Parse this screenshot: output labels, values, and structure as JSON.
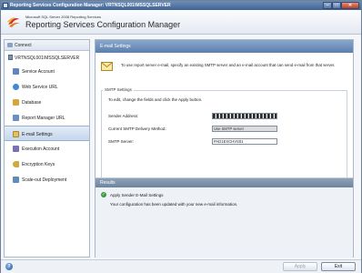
{
  "window": {
    "title": "Reporting Services Configuration Manager: VRTNSQL001\\MSSQLSERVER",
    "minimize_glyph": "–",
    "maximize_glyph": "□",
    "close_glyph": "✕"
  },
  "header": {
    "subtitle": "Microsoft SQL Server 2008 Reporting Services",
    "title": "Reporting Services Configuration Manager",
    "logo_icon": "sql-server-logo-icon"
  },
  "sidebar": {
    "connect_label": "Connect",
    "server_name": "VRTNSQL001\\MSSQLSERVER",
    "items": [
      {
        "label": "Service Account",
        "icon": "service-account-icon",
        "color": "#5f86c4"
      },
      {
        "label": "Web Service URL",
        "icon": "globe-icon",
        "color": "#3f8ad1"
      },
      {
        "label": "Database",
        "icon": "database-icon",
        "color": "#d9a53a"
      },
      {
        "label": "Report Manager URL",
        "icon": "report-manager-icon",
        "color": "#6a8fc4"
      },
      {
        "label": "E-mail Settings",
        "icon": "email-icon",
        "color": "#e4c05e"
      },
      {
        "label": "Execution Account",
        "icon": "execution-account-icon",
        "color": "#7a6fb8"
      },
      {
        "label": "Encryption Keys",
        "icon": "key-icon",
        "color": "#d1a83a"
      },
      {
        "label": "Scale-out Deployment",
        "icon": "scale-out-icon",
        "color": "#5d8ac0"
      }
    ],
    "selected_index": 4
  },
  "main": {
    "header": "E-mail Settings",
    "intro": "To use report server e-mail, specify an existing SMTP server and an e-mail account that can send e-mail from that server.",
    "smtp_group_label": "SMTP Settings",
    "instructions": "To edit, change the fields and click the Apply button.",
    "sender_label": "Sender Address:",
    "sender_value": "",
    "method_label": "Current SMTP Delivery Method:",
    "method_value": "Use SMTP server",
    "server_label": "SMTP Server:",
    "server_value": "PAD1EXCHVS01"
  },
  "results": {
    "header": "Results",
    "line1": "Apply Sender E-Mail Settings",
    "line2": "Your configuration has been updated with your new e-mail information."
  },
  "footer": {
    "help_glyph": "?",
    "apply_label": "Apply",
    "exit_label": "Exit"
  }
}
